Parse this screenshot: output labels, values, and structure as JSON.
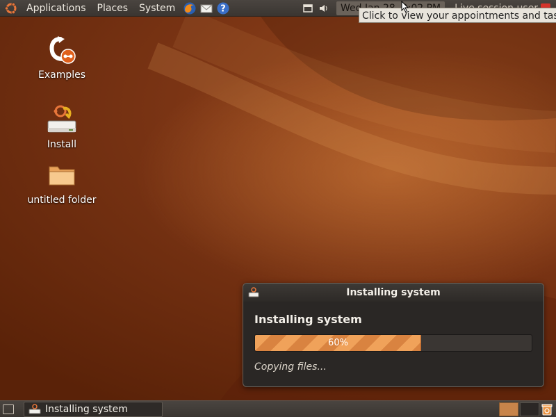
{
  "top_panel": {
    "menus": [
      "Applications",
      "Places",
      "System"
    ],
    "clock": "Wed Jan 28, 9:02 PM",
    "user": "Live session user"
  },
  "tooltip": "Click to view your appointments and tasks",
  "desktop": {
    "icons": [
      {
        "label": "Examples",
        "icon": "examples-icon"
      },
      {
        "label": "Install",
        "icon": "install-icon"
      },
      {
        "label": "untitled folder",
        "icon": "folder-icon"
      }
    ]
  },
  "installer": {
    "title": "Installing system",
    "heading": "Installing system",
    "progress": 0.6,
    "progress_label": "60%",
    "status": "Copying files..."
  },
  "bottom_panel": {
    "task_label": "Installing system"
  },
  "colors": {
    "accent": "#e8913f",
    "panel": "#3d3833",
    "wallpaper": "#7a3414"
  }
}
